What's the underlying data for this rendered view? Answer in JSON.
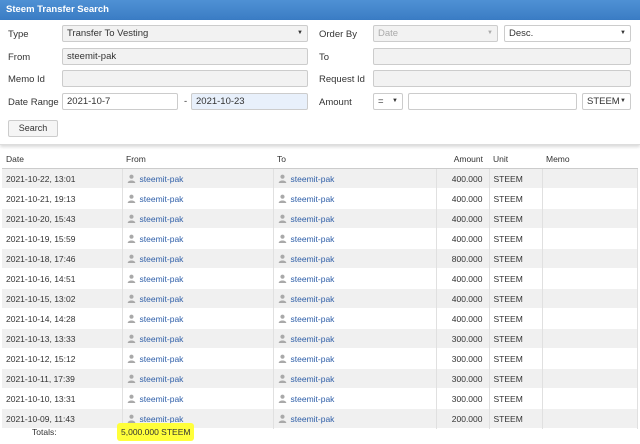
{
  "window": {
    "title": "Steem Transfer Search"
  },
  "form": {
    "type_label": "Type",
    "type_value": "Transfer To Vesting",
    "orderby_label": "Order By",
    "orderby_value": "Date",
    "order_dir_value": "Desc.",
    "from_label": "From",
    "from_value": "steemit-pak",
    "to_label": "To",
    "to_value": "",
    "memo_label": "Memo Id",
    "memo_value": "",
    "request_label": "Request Id",
    "request_value": "",
    "daterange_label": "Date Range",
    "date_from": "2021-10-7",
    "date_sep": "-",
    "date_to": "2021-10-23",
    "amount_label": "Amount",
    "amount_op": "=",
    "amount_value": "",
    "amount_unit": "STEEM",
    "search_label": "Search"
  },
  "table": {
    "headers": {
      "date": "Date",
      "from": "From",
      "to": "To",
      "amount": "Amount",
      "unit": "Unit",
      "memo": "Memo"
    },
    "rows": [
      {
        "date": "2021-10-22, 13:01",
        "from": "steemit-pak",
        "to": "steemit-pak",
        "amount": "400.000",
        "unit": "STEEM",
        "memo": ""
      },
      {
        "date": "2021-10-21, 19:13",
        "from": "steemit-pak",
        "to": "steemit-pak",
        "amount": "400.000",
        "unit": "STEEM",
        "memo": ""
      },
      {
        "date": "2021-10-20, 15:43",
        "from": "steemit-pak",
        "to": "steemit-pak",
        "amount": "400.000",
        "unit": "STEEM",
        "memo": ""
      },
      {
        "date": "2021-10-19, 15:59",
        "from": "steemit-pak",
        "to": "steemit-pak",
        "amount": "400.000",
        "unit": "STEEM",
        "memo": ""
      },
      {
        "date": "2021-10-18, 17:46",
        "from": "steemit-pak",
        "to": "steemit-pak",
        "amount": "800.000",
        "unit": "STEEM",
        "memo": ""
      },
      {
        "date": "2021-10-16, 14:51",
        "from": "steemit-pak",
        "to": "steemit-pak",
        "amount": "400.000",
        "unit": "STEEM",
        "memo": ""
      },
      {
        "date": "2021-10-15, 13:02",
        "from": "steemit-pak",
        "to": "steemit-pak",
        "amount": "400.000",
        "unit": "STEEM",
        "memo": ""
      },
      {
        "date": "2021-10-14, 14:28",
        "from": "steemit-pak",
        "to": "steemit-pak",
        "amount": "400.000",
        "unit": "STEEM",
        "memo": ""
      },
      {
        "date": "2021-10-13, 13:33",
        "from": "steemit-pak",
        "to": "steemit-pak",
        "amount": "300.000",
        "unit": "STEEM",
        "memo": ""
      },
      {
        "date": "2021-10-12, 15:12",
        "from": "steemit-pak",
        "to": "steemit-pak",
        "amount": "300.000",
        "unit": "STEEM",
        "memo": ""
      },
      {
        "date": "2021-10-11, 17:39",
        "from": "steemit-pak",
        "to": "steemit-pak",
        "amount": "300.000",
        "unit": "STEEM",
        "memo": ""
      },
      {
        "date": "2021-10-10, 13:31",
        "from": "steemit-pak",
        "to": "steemit-pak",
        "amount": "300.000",
        "unit": "STEEM",
        "memo": ""
      },
      {
        "date": "2021-10-09, 11:43",
        "from": "steemit-pak",
        "to": "steemit-pak",
        "amount": "200.000",
        "unit": "STEEM",
        "memo": ""
      }
    ]
  },
  "totals": {
    "label": "Totals:",
    "value": "5,000.000 STEEM"
  },
  "colors": {
    "titlebar": "#3a7cc4",
    "link": "#2f5fa8",
    "highlight": "#ffff3a",
    "row_alt": "#f0f0f0"
  },
  "icons": {
    "account": "user-icon",
    "dropdown": "caret-down-icon"
  }
}
